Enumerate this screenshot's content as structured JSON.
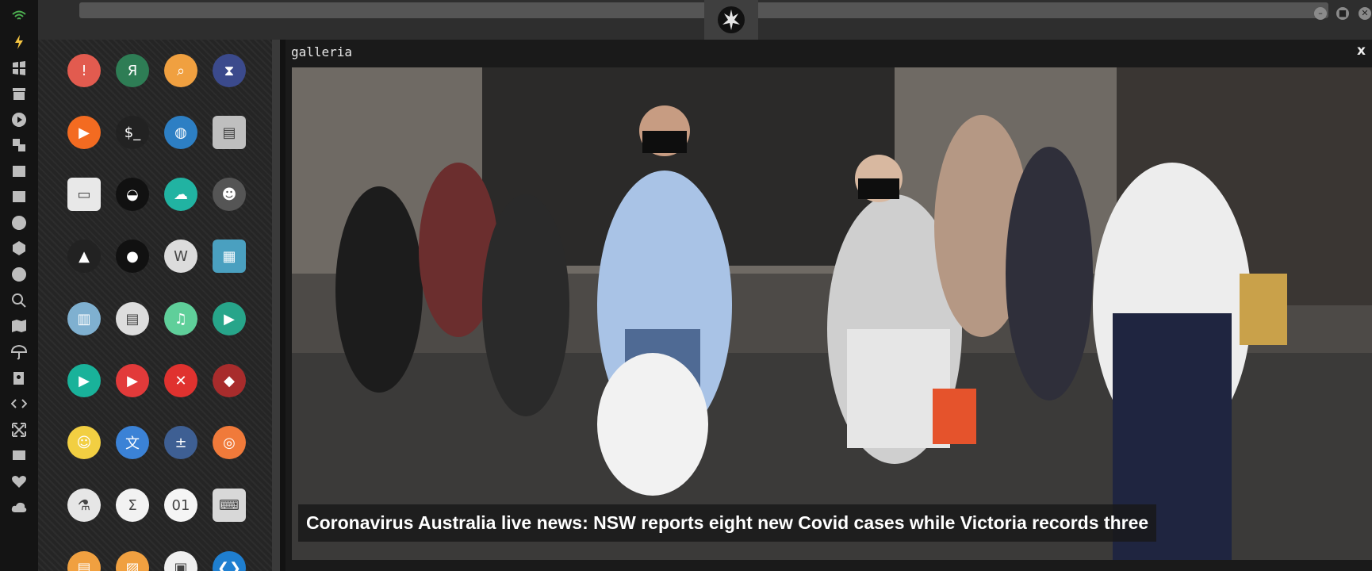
{
  "dock": {
    "items": [
      "wifi-icon",
      "bolt-icon",
      "windows-icon",
      "archive-icon",
      "play-icon",
      "translate-icon",
      "image-icon",
      "news-icon",
      "rebel-icon",
      "hexagon-icon",
      "globe-icon",
      "search-icon",
      "map-icon",
      "umbrella-icon",
      "contacts-icon",
      "code-icon",
      "expand-icon",
      "youtube-icon",
      "heart-icon",
      "cloud-icon"
    ]
  },
  "window": {
    "controls": {
      "minimize": "–",
      "maximize": "■",
      "close": "✕"
    }
  },
  "apps": [
    {
      "name": "warning-app-icon",
      "glyph": "!",
      "color": "#e25b4f"
    },
    {
      "name": "yandex-app-icon",
      "glyph": "Я",
      "color": "#2e7d55"
    },
    {
      "name": "search-app-icon",
      "glyph": "⌕",
      "color": "#f0a040"
    },
    {
      "name": "hourglass-app-icon",
      "glyph": "⧗",
      "color": "#3b4a8c"
    },
    {
      "name": "arrow-app-icon",
      "glyph": "▶",
      "color": "#f36b21"
    },
    {
      "name": "terminal-app-icon",
      "glyph": "$_",
      "color": "#222"
    },
    {
      "name": "web-app-icon",
      "glyph": "◍",
      "color": "#2d7fc4"
    },
    {
      "name": "storage-app-icon",
      "glyph": "▤",
      "color": "#bfbfbf"
    },
    {
      "name": "window-app-icon",
      "glyph": "▭",
      "color": "#e8e8e8"
    },
    {
      "name": "helmet-app-icon",
      "glyph": "◒",
      "color": "#111"
    },
    {
      "name": "cloud-lock-app-icon",
      "glyph": "☁",
      "color": "#21b3a2"
    },
    {
      "name": "github-app-icon",
      "glyph": "☻",
      "color": "#555"
    },
    {
      "name": "starfleet-app-icon",
      "glyph": "▲",
      "color": "#222"
    },
    {
      "name": "death-star-app-icon",
      "glyph": "●",
      "color": "#111"
    },
    {
      "name": "wikipedia-app-icon",
      "glyph": "W",
      "color": "#dcdcdc"
    },
    {
      "name": "world-map-app-icon",
      "glyph": "▦",
      "color": "#4aa0c0"
    },
    {
      "name": "books-app-icon",
      "glyph": "▥",
      "color": "#7fb0d0"
    },
    {
      "name": "notepad-app-icon",
      "glyph": "▤",
      "color": "#dddddd"
    },
    {
      "name": "music-app-icon",
      "glyph": "♫",
      "color": "#5fcf9a"
    },
    {
      "name": "video-app-icon",
      "glyph": "▶",
      "color": "#27a58a"
    },
    {
      "name": "player-app-icon",
      "glyph": "▶",
      "color": "#19b29a"
    },
    {
      "name": "youtube-red-app-icon",
      "glyph": "▶",
      "color": "#e23a3a"
    },
    {
      "name": "close-red-app-icon",
      "glyph": "✕",
      "color": "#e0322f"
    },
    {
      "name": "ironman-app-icon",
      "glyph": "◆",
      "color": "#a82c2c"
    },
    {
      "name": "robot-app-icon",
      "glyph": "☺",
      "color": "#f2cf42"
    },
    {
      "name": "translate-app-icon",
      "glyph": "文",
      "color": "#3b82d6"
    },
    {
      "name": "calculator-app-icon",
      "glyph": "±",
      "color": "#3e5f93"
    },
    {
      "name": "photos-app-icon",
      "glyph": "◎",
      "color": "#f07a3a"
    },
    {
      "name": "flask-app-icon",
      "glyph": "⚗",
      "color": "#e6e6e6"
    },
    {
      "name": "sigma-app-icon",
      "glyph": "Σ",
      "color": "#f2f2f2"
    },
    {
      "name": "binary-app-icon",
      "glyph": "01",
      "color": "#f5f5f5"
    },
    {
      "name": "keyboard-app-icon",
      "glyph": "⌨",
      "color": "#d8d8d8"
    },
    {
      "name": "document-app-icon",
      "glyph": "▤",
      "color": "#f0a040"
    },
    {
      "name": "image-viewer-app-icon",
      "glyph": "▨",
      "color": "#f0a040"
    },
    {
      "name": "presentation-app-icon",
      "glyph": "▣",
      "color": "#f0f0f0"
    },
    {
      "name": "vscode-app-icon",
      "glyph": "❮❯",
      "color": "#1f7fd0"
    }
  ],
  "gallery": {
    "title": "galleria",
    "close_label": "x",
    "caption": "Coronavirus Australia live news: NSW reports eight new Covid cases while Victoria records three"
  }
}
